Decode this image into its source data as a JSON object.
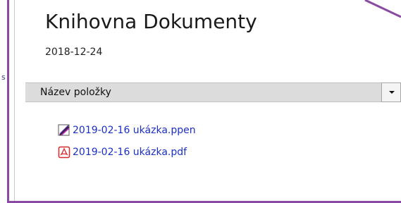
{
  "library": {
    "title": "Knihovna Dokumenty",
    "date": "2018-12-24"
  },
  "edge_mark": "s",
  "list_header": {
    "column_label": "Název položky",
    "sort_icon": "chevron-down-icon"
  },
  "files": [
    {
      "name": "2019-02-16 ukázka.ppen",
      "icon": "pen-drawing-icon"
    },
    {
      "name": "2019-02-16 ukázka.pdf",
      "icon": "pdf-icon"
    }
  ],
  "colors": {
    "frame": "#8a4aa3",
    "link": "#1b2fc4",
    "header_bg": "#dcdcdc",
    "pdf_red": "#d9262a"
  }
}
